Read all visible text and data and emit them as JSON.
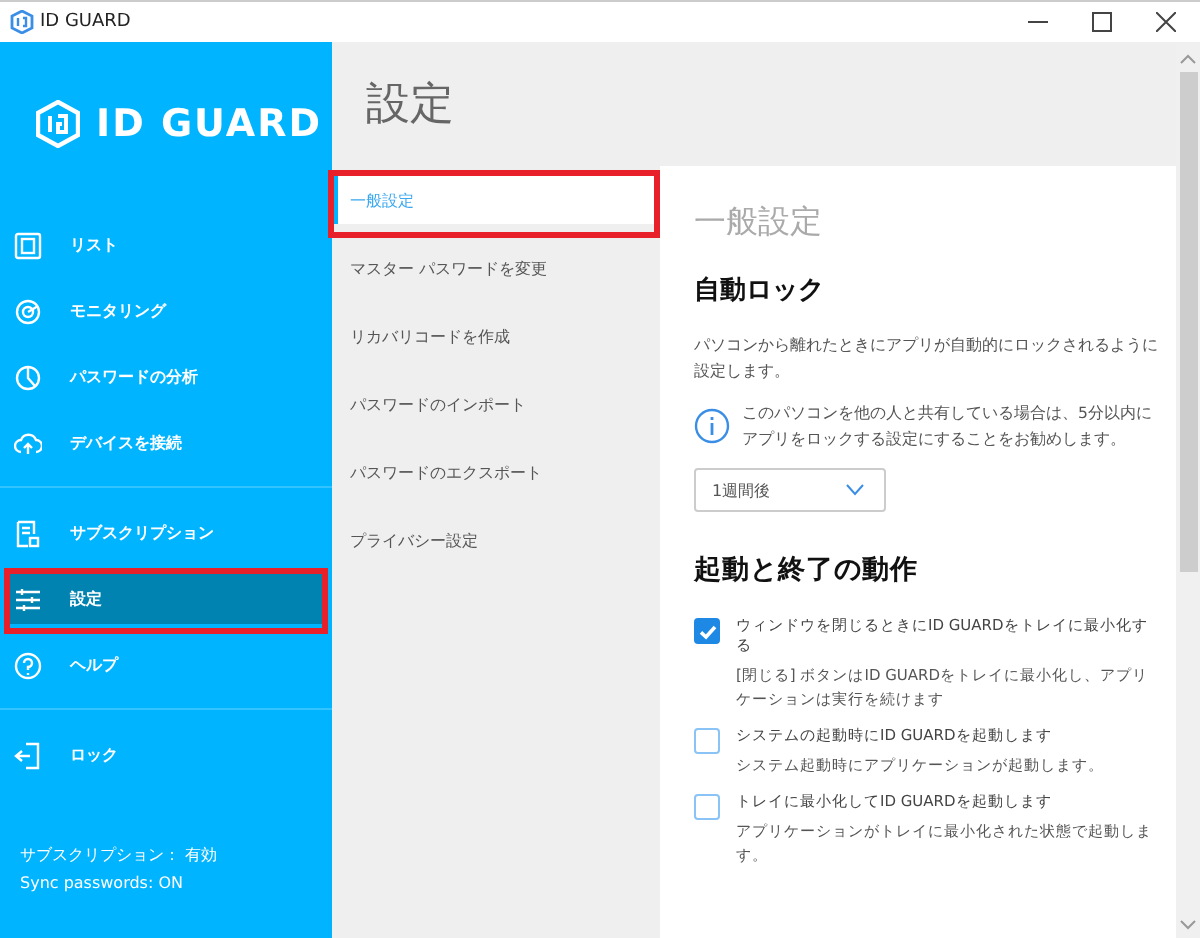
{
  "window": {
    "title": "ID GUARD"
  },
  "sidebar": {
    "logo": "ID GUARD",
    "groups": [
      [
        {
          "label": "リスト",
          "selected": false,
          "highlighted": false
        },
        {
          "label": "モニタリング",
          "selected": false,
          "highlighted": false
        },
        {
          "label": "パスワードの分析",
          "selected": false,
          "highlighted": false
        },
        {
          "label": "デバイスを接続",
          "selected": false,
          "highlighted": false
        }
      ],
      [
        {
          "label": "サブスクリプション",
          "selected": false,
          "highlighted": false
        },
        {
          "label": "設定",
          "selected": true,
          "highlighted": true
        },
        {
          "label": "ヘルプ",
          "selected": false,
          "highlighted": false
        }
      ],
      [
        {
          "label": "ロック",
          "selected": false,
          "highlighted": false
        }
      ]
    ],
    "status": [
      "サブスクリプション： 有効",
      "Sync passwords: ON"
    ]
  },
  "page_title": "設定",
  "submenu": [
    {
      "label": "一般設定",
      "selected": true,
      "highlighted": true
    },
    {
      "label": "マスター パスワードを変更",
      "selected": false,
      "highlighted": false
    },
    {
      "label": "リカバリコードを作成",
      "selected": false,
      "highlighted": false
    },
    {
      "label": "パスワードのインポート",
      "selected": false,
      "highlighted": false
    },
    {
      "label": "パスワードのエクスポート",
      "selected": false,
      "highlighted": false
    },
    {
      "label": "プライバシー設定",
      "selected": false,
      "highlighted": false
    }
  ],
  "content": {
    "heading": "一般設定",
    "auto_lock": {
      "title": "自動ロック",
      "description": "パソコンから離れたときにアプリが自動的にロックされるように設定します。",
      "info": "このパソコンを他の人と共有している場合は、5分以内にアプリをロックする設定にすることをお勧めします。",
      "select": "1週間後"
    },
    "startup": {
      "title": "起動と終了の動作",
      "options": [
        {
          "label": "ウィンドウを閉じるときにID GUARDをトレイに最小化する",
          "description": "[閉じる] ボタンはID GUARDをトレイに最小化し、アプリケーションは実行を続けます",
          "checked": true
        },
        {
          "label": "システムの起動時にID GUARDを起動します",
          "description": "システム起動時にアプリケーションが起動します。",
          "checked": false
        },
        {
          "label": "トレイに最小化してID GUARDを起動します",
          "description": "アプリケーションがトレイに最小化された状態で起動します。",
          "checked": false
        }
      ]
    }
  }
}
